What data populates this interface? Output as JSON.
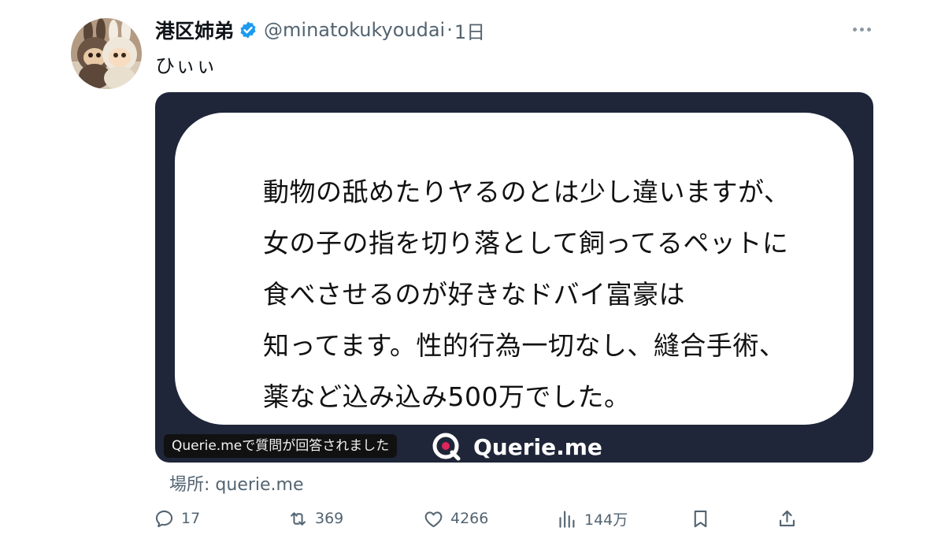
{
  "post": {
    "display_name": "港区姉弟",
    "handle": "@minatokukyoudai",
    "separator": "·",
    "time": "1日",
    "text": "ひぃぃ",
    "location": "場所: querie.me"
  },
  "card": {
    "lines": [
      "動物の舐めたりヤるのとは少し違いますが、",
      "女の子の指を切り落として飼ってるペットに",
      "食べさせるのが好きなドバイ富豪は",
      "知ってます。性的行為一切なし、縫合手術、",
      "薬など込み込み500万でした。"
    ],
    "answered_label": "Querie.meで質問が回答されました",
    "brand_name": "Querie.me"
  },
  "actions": {
    "reply_count": "17",
    "repost_count": "369",
    "like_count": "4266",
    "views_count": "144万"
  },
  "colors": {
    "verified": "#1d9bf0",
    "card_background": "#1f2639",
    "brand_accent": "#e0245e",
    "icon_gray": "#536471"
  },
  "icons": [
    "verified-badge-icon",
    "more-icon",
    "querie-logo-icon",
    "reply-icon",
    "repost-icon",
    "like-icon",
    "views-icon",
    "bookmark-icon",
    "share-icon"
  ]
}
